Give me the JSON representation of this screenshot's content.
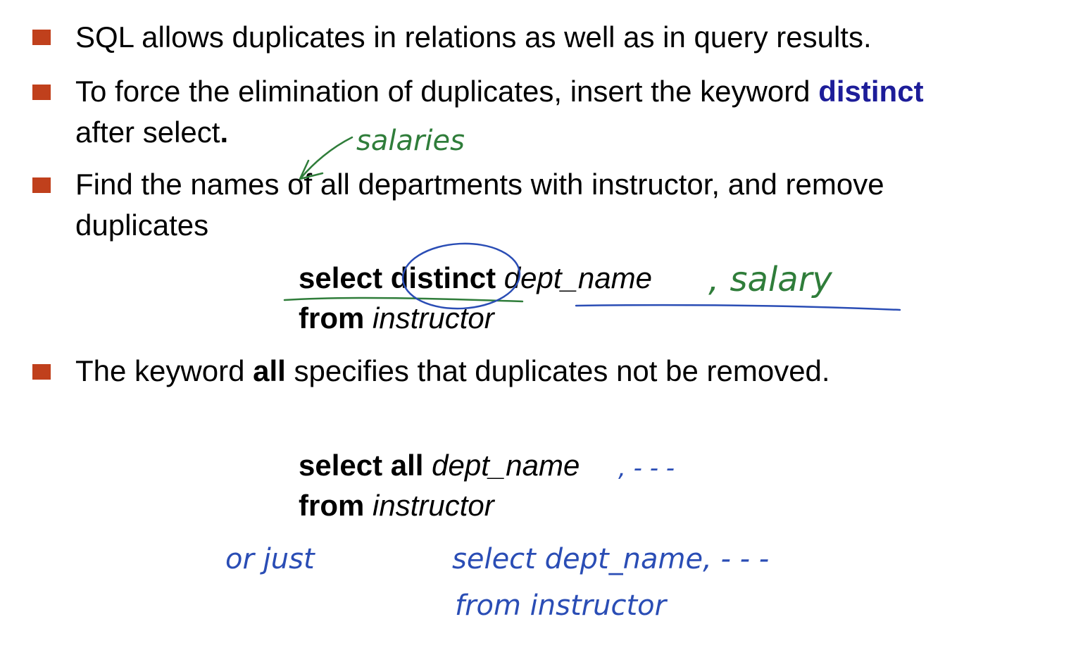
{
  "bullets": [
    {
      "text": "SQL allows duplicates in relations as well as in query results."
    },
    {
      "line1_pre": "To force the elimination of duplicates, insert the keyword ",
      "line1_kw": "distinct",
      "line2_pre": "after select",
      "line2_dot": "."
    },
    {
      "line1": "Find the names of all departments with instructor, and remove",
      "line2": "duplicates"
    },
    {
      "pre": "The keyword ",
      "kw": "all",
      "post": " specifies that duplicates not be removed."
    }
  ],
  "query1": {
    "select_kw": "select",
    "distinct_kw": "distinct",
    "column": "dept_name",
    "from_kw": "from",
    "table": "instructor"
  },
  "query2": {
    "select_all_kw": "select all",
    "column": "dept_name",
    "from_kw": "from",
    "table": "instructor"
  },
  "annotations": {
    "salaries": "salaries",
    "salary": ", salary",
    "ellipsis1": ", - - -",
    "or_just": "or   just",
    "select_line": "select  dept_name, - - -",
    "from_line": "from  instructor"
  },
  "colors": {
    "bullet": "#c0401c",
    "keyword_blue": "#1d1d99",
    "ink_green": "#2f7d3a",
    "ink_blue": "#2a4db5"
  }
}
